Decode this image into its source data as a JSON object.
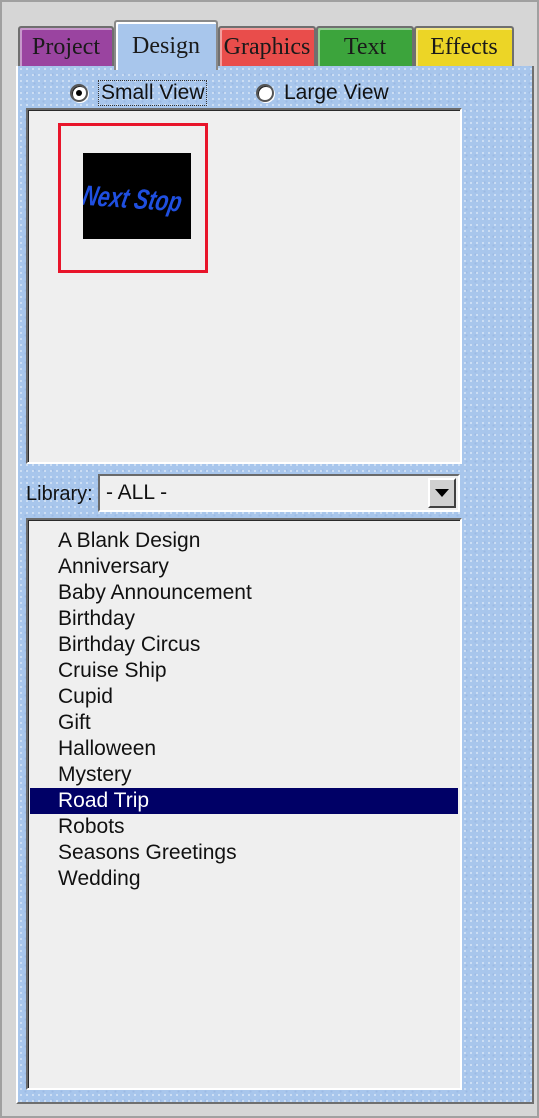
{
  "tabs": [
    {
      "label": "Project",
      "color": "#9a44a0",
      "active": false
    },
    {
      "label": "Design",
      "color": "#a8c6ec",
      "active": true
    },
    {
      "label": "Graphics",
      "color": "#e94d4b",
      "active": false
    },
    {
      "label": "Text",
      "color": "#3ca43c",
      "active": false
    },
    {
      "label": "Effects",
      "color": "#ecd526",
      "active": false
    }
  ],
  "view": {
    "small_label": "Small View",
    "large_label": "Large View",
    "selected": "small"
  },
  "preview": {
    "thumbnail_text": "Next Stop",
    "selection_color": "#e8142a",
    "text_color": "#1f4fe0"
  },
  "library": {
    "label": "Library:",
    "value": "- ALL -"
  },
  "designs": {
    "selected_index": 10,
    "items": [
      "A Blank Design",
      "Anniversary",
      "Baby Announcement",
      "Birthday",
      "Birthday Circus",
      "Cruise Ship",
      "Cupid",
      "Gift",
      "Halloween",
      "Mystery",
      "Road Trip",
      "Robots",
      "Seasons Greetings",
      "Wedding"
    ]
  },
  "colors": {
    "panel": "#a8c6ec",
    "selection_bg": "#000066"
  }
}
